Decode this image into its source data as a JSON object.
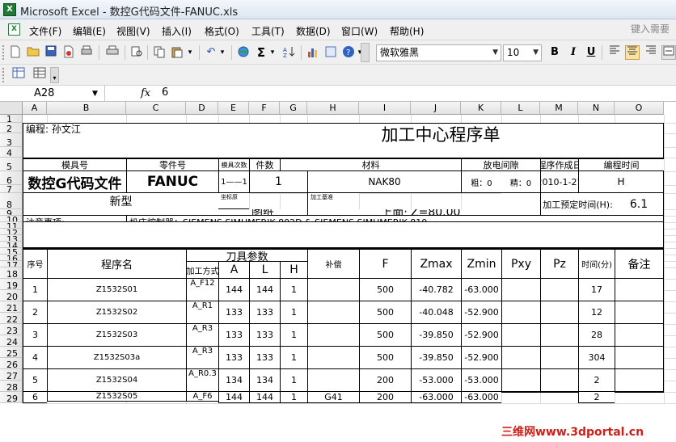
{
  "window": {
    "title": "Microsoft Excel - 数控G代码文件-FANUC.xls",
    "app_icon": "X"
  },
  "menu": {
    "items": [
      "文件(F)",
      "编辑(E)",
      "视图(V)",
      "插入(I)",
      "格式(O)",
      "工具(T)",
      "数据(D)",
      "窗口(W)",
      "帮助(H)"
    ],
    "help_search_placeholder": "键入需要"
  },
  "toolbar": {
    "font_name": "微软雅黑",
    "font_size": "10",
    "bold_label": "B",
    "italic_label": "I",
    "underline_label": "U",
    "sum_label": "Σ"
  },
  "formula_bar": {
    "name_box": "A28",
    "fx_label": "fx",
    "value": "6"
  },
  "columns": [
    "A",
    "B",
    "C",
    "D",
    "E",
    "F",
    "G",
    "H",
    "I",
    "J",
    "K",
    "L",
    "M",
    "N",
    "O"
  ],
  "rows": [
    "1",
    "2",
    "3",
    "4",
    "5",
    "6",
    "7",
    "8",
    "9",
    "10",
    "11",
    "12",
    "13",
    "14",
    "15",
    "16",
    "17",
    "18",
    "19",
    "20",
    "21",
    "22",
    "23",
    "24",
    "25",
    "26",
    "27",
    "28",
    "29"
  ],
  "sheet": {
    "programmer": "编程: 孙文江",
    "title": "加工中心程序单",
    "header": {
      "mold_no": "模具号",
      "part_no": "零件号",
      "mold_times": "模具次数",
      "quantity": "件数",
      "material": "材料",
      "edm_gap": "放电间隙",
      "program_date": "程序作成日",
      "program_time": "编程时间"
    },
    "values": {
      "mold_no": "数控G代码文件",
      "part_no": "FANUC",
      "mold_times": "1——1",
      "quantity": "1",
      "material": "NAK80",
      "rough": "粗：0",
      "fine": "精：0",
      "date": "2010-1-27",
      "time": "H"
    },
    "row8": {
      "new_type": "新型",
      "coord": "坐标原",
      "drawing": "图纸",
      "base": "加工基准",
      "top": "上面:",
      "z": "Z=80.00",
      "est_label": "加工预定时间(H):",
      "est_value": "6.1"
    },
    "notes_label": "注意事项:",
    "controller": "机床控制器：SIEMENS SIMUMERIK 802D & SIEMENS SIMUMERIK 810",
    "table_headers": {
      "seq": "序号",
      "prog_name": "程序名",
      "tool_params": "刀具参数",
      "method": "加工方式",
      "A": "A",
      "L": "L",
      "H": "H",
      "comp": "补偿",
      "F": "F",
      "zmax": "Zmax",
      "zmin": "Zmin",
      "pxy": "Pxy",
      "pz": "Pz",
      "time": "时间(分)",
      "remarks": "备注"
    },
    "programs": [
      {
        "seq": "1",
        "name": "Z1532S01",
        "method": "A_F12",
        "A": "144",
        "L": "144",
        "H": "1",
        "comp": "",
        "F": "500",
        "zmax": "-40.782",
        "zmin": "-63.000",
        "time": "17"
      },
      {
        "seq": "2",
        "name": "Z1532S02",
        "method": "A_R1",
        "A": "133",
        "L": "133",
        "H": "1",
        "comp": "",
        "F": "500",
        "zmax": "-40.048",
        "zmin": "-52.900",
        "time": "12"
      },
      {
        "seq": "3",
        "name": "Z1532S03",
        "method": "A_R3",
        "A": "133",
        "L": "133",
        "H": "1",
        "comp": "",
        "F": "500",
        "zmax": "-39.850",
        "zmin": "-52.900",
        "time": "28"
      },
      {
        "seq": "4",
        "name": "Z1532S03a",
        "method": "A_R3",
        "A": "133",
        "L": "133",
        "H": "1",
        "comp": "",
        "F": "500",
        "zmax": "-39.850",
        "zmin": "-52.900",
        "time": "304"
      },
      {
        "seq": "5",
        "name": "Z1532S04",
        "method": "A_R0.3",
        "A": "134",
        "L": "134",
        "H": "1",
        "comp": "",
        "F": "200",
        "zmax": "-53.000",
        "zmin": "-53.000",
        "time": "2"
      },
      {
        "seq": "6",
        "name": "Z1532S05",
        "method": "A_F6",
        "A": "144",
        "L": "144",
        "H": "1",
        "comp": "G41",
        "F": "200",
        "zmax": "-63.000",
        "zmin": "-63.000",
        "time": "2"
      }
    ]
  },
  "watermark": "三维网www.3dportal.cn"
}
